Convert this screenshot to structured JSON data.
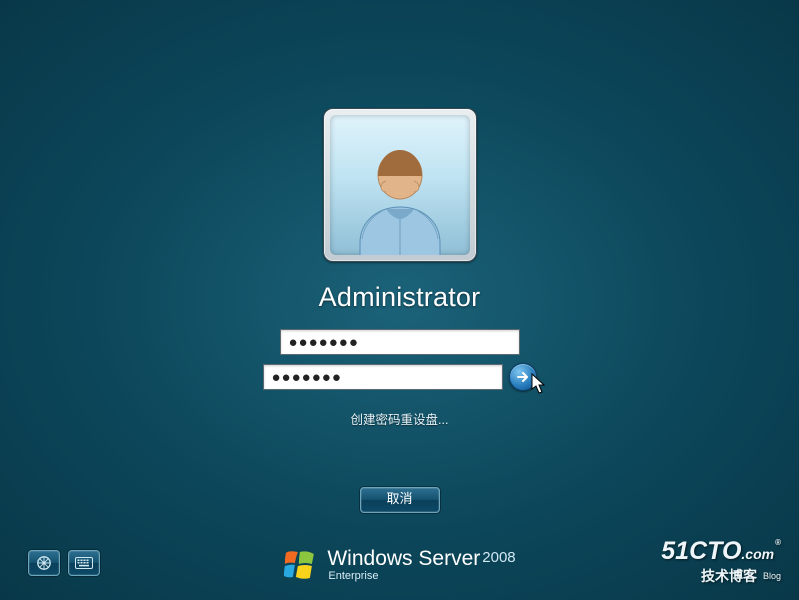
{
  "login": {
    "username": "Administrator",
    "password1_masked": "●●●●●●●",
    "password2_masked": "●●●●●●●",
    "reset_link": "创建密码重设盘...",
    "cancel": "取消"
  },
  "branding": {
    "product_thin": "Windows",
    "product_mid": "Server",
    "year": "2008",
    "edition": "Enterprise"
  },
  "watermark": {
    "site": "51CTO",
    "dot": ".com",
    "r": "®",
    "sub_cn": "技术博客",
    "sub_en": "Blog"
  },
  "accessibility": {
    "ease_button": "ease-of-access",
    "keyboard_button": "on-screen-keyboard"
  }
}
